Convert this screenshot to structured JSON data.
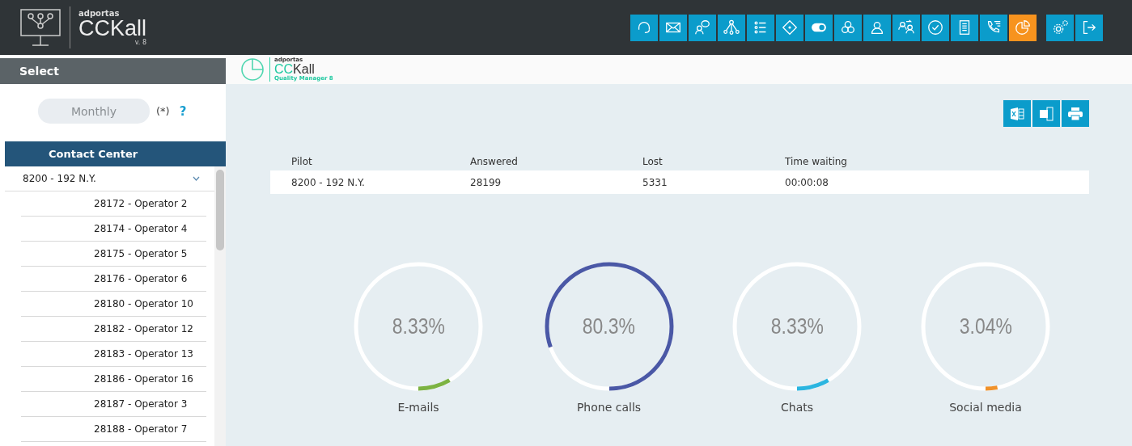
{
  "header": {
    "brand": "adportas",
    "product": "CCKall",
    "version": "v. 8"
  },
  "toolbar": [
    {
      "selected": false
    },
    {
      "selected": false
    },
    {
      "selected": false
    },
    {
      "selected": false
    },
    {
      "selected": false
    },
    {
      "selected": false
    },
    {
      "selected": false
    },
    {
      "selected": false
    },
    {
      "selected": false
    },
    {
      "selected": false
    },
    {
      "selected": false
    },
    {
      "selected": false
    },
    {
      "selected": false
    },
    {
      "selected": true
    }
  ],
  "toolbar_extra": [
    {
      "selected": false
    },
    {
      "selected": false
    }
  ],
  "sidebar": {
    "title": "Select",
    "period": "Monthly",
    "note": "(*)",
    "help": "?",
    "section": "Contact Center",
    "tree": [
      {
        "label": "8200 - 192 N.Y.",
        "expanded": true,
        "children": [
          {
            "label": "28172 - Operator 2"
          },
          {
            "label": "28174 - Operator 4"
          },
          {
            "label": "28175 - Operator 5"
          },
          {
            "label": "28176 - Operator 6"
          },
          {
            "label": "28180 - Operator 10"
          },
          {
            "label": "28182 - Operator 12"
          },
          {
            "label": "28183 - Operator 13"
          },
          {
            "label": "28186 - Operator 16"
          },
          {
            "label": "28187 - Operator 3"
          },
          {
            "label": "28188 - Operator 7"
          }
        ]
      }
    ]
  },
  "module": {
    "brand": "adportas",
    "product_a": "CC",
    "product_b": "Kall",
    "subtitle": "Quality Manager 8"
  },
  "table": {
    "columns": [
      "Pilot",
      "Answered",
      "Lost",
      "Time waiting"
    ],
    "rows": [
      [
        "8200 - 192 N.Y.",
        "28199",
        "5331",
        "00:00:08"
      ]
    ]
  },
  "gauges": [
    {
      "value": "8.33%",
      "label": "E-mails",
      "level": 0.0833,
      "color": "#7cb342"
    },
    {
      "value": "80.3%",
      "label": "Phone calls",
      "level": 0.803,
      "color": "#4a58a6"
    },
    {
      "value": "8.33%",
      "label": "Chats",
      "level": 0.0833,
      "color": "#2bb5e0"
    },
    {
      "value": "3.04%",
      "label": "Social media",
      "level": 0.0304,
      "color": "#f0922b"
    }
  ]
}
